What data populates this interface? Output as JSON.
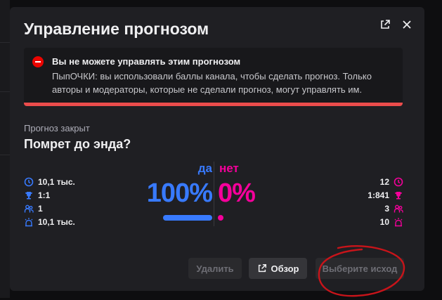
{
  "modal": {
    "title": "Управление прогнозом",
    "popout_icon": "external-link-icon",
    "close_icon": "close-icon"
  },
  "alert": {
    "icon": "error-minus-icon",
    "title": "Вы не можете управлять этим прогнозом",
    "text": "ПыпОЧКИ: вы использовали баллы канала, чтобы сделать прогноз. Только авторы и модераторы, которые не сделали прогноз, могут управлять им.",
    "color": "#eb4c4c"
  },
  "prediction": {
    "status": "Прогноз закрыт",
    "question": "Помрет до энда?"
  },
  "outcomes": {
    "yes": {
      "label": "да",
      "percent": "100%",
      "share": 1.0,
      "color": "#387aff",
      "stats": {
        "points": "10,1 тыс.",
        "ratio": "1:1",
        "users": "1",
        "top_bet": "10,1 тыс."
      }
    },
    "no": {
      "label": "нет",
      "percent": "0%",
      "share": 0.0,
      "color": "#f5009b",
      "stats": {
        "points": "12",
        "ratio": "1:841",
        "users": "3",
        "top_bet": "10"
      }
    }
  },
  "stat_icons": [
    "points-icon",
    "trophy-icon",
    "users-icon",
    "top-bet-icon"
  ],
  "buttons": {
    "delete": "Удалить",
    "review": "Обзор",
    "choose_outcome": "Выберите исход"
  }
}
